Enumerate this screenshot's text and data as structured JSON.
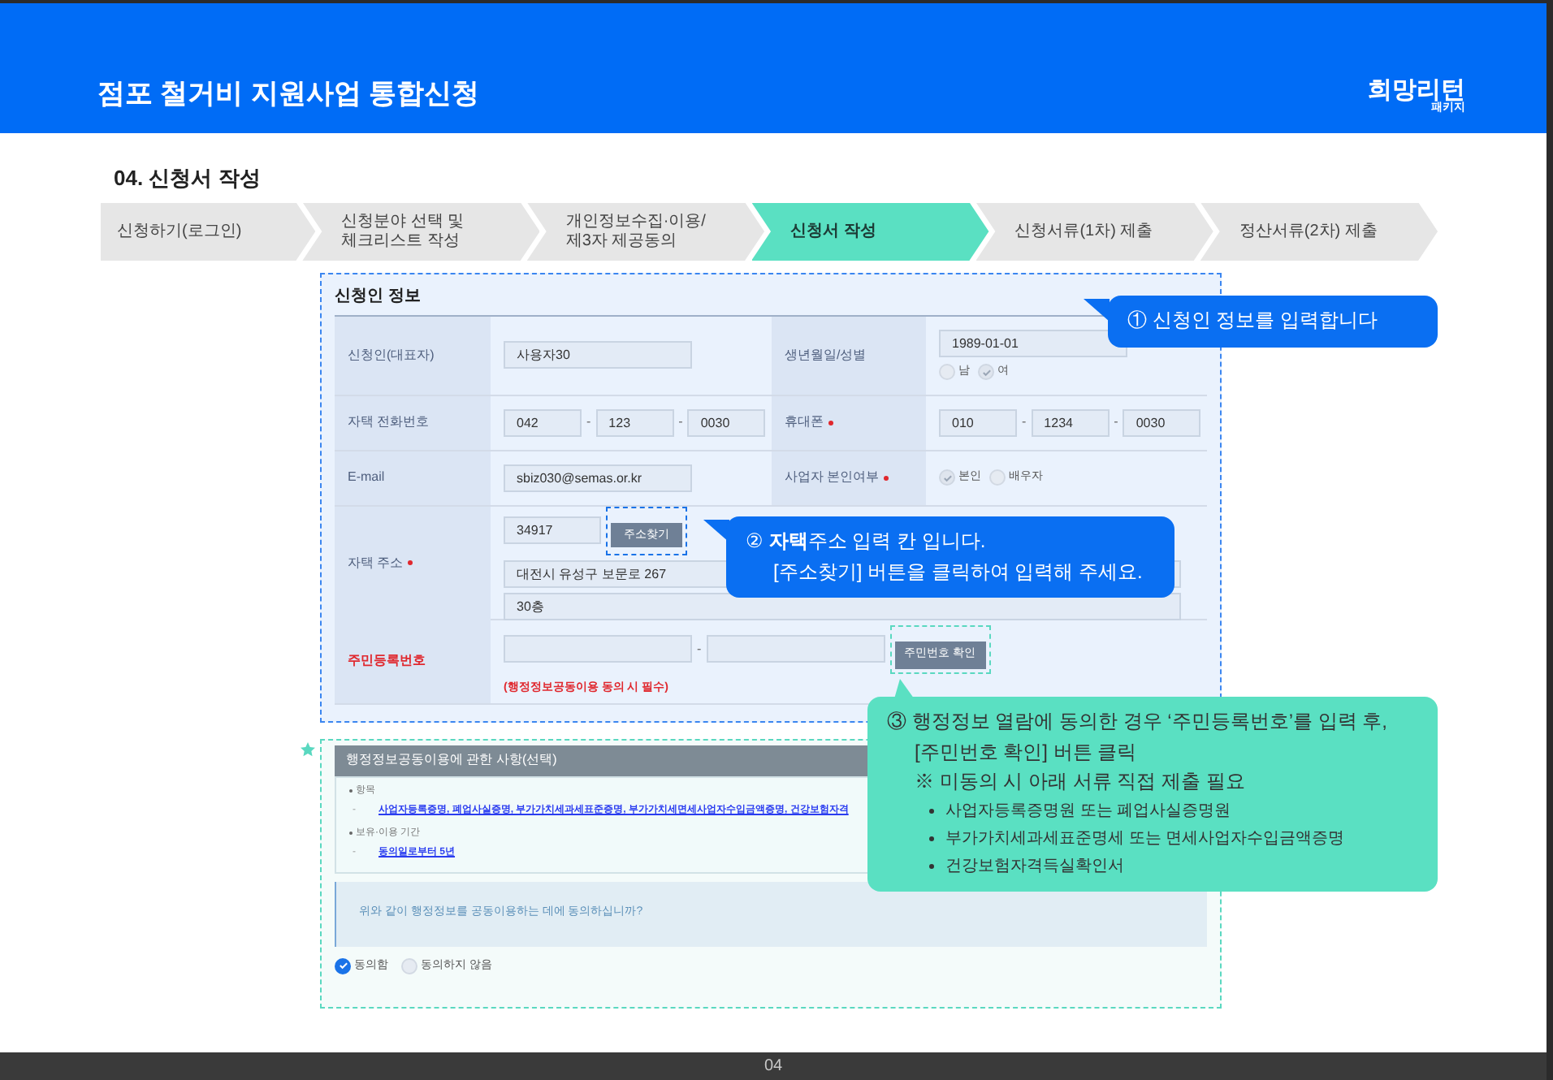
{
  "header": {
    "title": "점포 철거비 지원사업 통합신청",
    "logo": {
      "main": "희망리턴",
      "sub": "패키지"
    }
  },
  "section_title": "04. 신청서 작성",
  "steps": [
    {
      "label": "신청하기(로그인)",
      "selected": false
    },
    {
      "label": "신청분야 선택 및\n체크리스트 작성",
      "selected": false
    },
    {
      "label": "개인정보수집·이용/\n제3자 제공동의",
      "selected": false
    },
    {
      "label": "신청서 작성",
      "selected": true
    },
    {
      "label": "신청서류(1차) 제출",
      "selected": false
    },
    {
      "label": "정산서류(2차) 제출",
      "selected": false
    }
  ],
  "applicant_form": {
    "title": "신청인 정보",
    "rows": [
      {
        "cells": [
          {
            "label": "신청인(대표자)",
            "required": false,
            "kind": "text",
            "value": "사용자30"
          },
          {
            "label": "생년월일/성별",
            "required": false,
            "kind": "date_gender",
            "value": "1989-01-01",
            "options": [
              {
                "label": "남",
                "checked": false
              },
              {
                "label": "여",
                "checked": true
              }
            ]
          }
        ]
      },
      {
        "cells": [
          {
            "label": "자택 전화번호",
            "required": false,
            "kind": "phone",
            "parts": [
              "042",
              "123",
              "0030"
            ],
            "separator": "-"
          },
          {
            "label": "휴대폰",
            "required": true,
            "kind": "phone",
            "parts": [
              "010",
              "1234",
              "0030"
            ],
            "separator": "-"
          }
        ]
      },
      {
        "cells": [
          {
            "label": "E-mail",
            "required": false,
            "kind": "text",
            "value": "sbiz030@semas.or.kr"
          },
          {
            "label": "사업자 본인여부",
            "required": true,
            "kind": "radio",
            "options": [
              {
                "label": "본인",
                "checked": true
              },
              {
                "label": "배우자",
                "checked": false
              }
            ]
          }
        ]
      },
      {
        "cells": [
          {
            "label": "자택 주소",
            "required": true,
            "kind": "address",
            "zip": "34917",
            "button": {
              "label": "주소찾기",
              "highlighted": true
            },
            "lines": [
              "대전시 유성구 보문로 267",
              "30층"
            ]
          }
        ]
      },
      {
        "cells": [
          {
            "label": "주민등록번호",
            "required": false,
            "emphasis": true,
            "kind": "rrn",
            "separator": "-",
            "button": {
              "label": "주민번호 확인",
              "highlighted": true
            },
            "note": "(행정정보공동이용 동의 시 필수)"
          }
        ]
      }
    ]
  },
  "consent": {
    "title": "행정정보공동이용에 관한 사항(선택)",
    "items": [
      {
        "heading": "항목",
        "marker": "-",
        "link": "사업자등록증명, 폐업사실증명, 부가가치세과세표준증명, 부가가치세면세사업자수입금액증명, 건강보험자격"
      },
      {
        "heading": "보유·이용 기간",
        "marker": "-",
        "link": "동의일로부터 5년"
      }
    ],
    "question": "위와 같이 행정정보를 공동이용하는 데에 동의하십니까?",
    "options": [
      {
        "label": "동의함",
        "selected": true
      },
      {
        "label": "동의하지 않음",
        "selected": false
      }
    ]
  },
  "callouts": [
    {
      "kind": "blue",
      "lines": [
        "① 신청인 정보를 입력합니다"
      ]
    },
    {
      "kind": "blue",
      "lines": [
        "② **자택**주소 입력 칸 입니다.",
        "[주소찾기] 버튼을 클릭하여 입력해 주세요."
      ]
    },
    {
      "kind": "teal",
      "lines": [
        "③ 행정정보 열람에 동의한 경우 ‘주민등록번호’를 입력 후,",
        "[주민번호 확인] 버튼 클릭",
        "※ 미동의 시 아래 서류 직접 제출 필요"
      ],
      "bullets": [
        "사업자등록증명원 또는 폐업사실증명원",
        "부가가치세과세표준명세 또는 면세사업자수입금액증명",
        "건강보험자격득실확인서"
      ]
    }
  ],
  "footer": {
    "page": "04"
  }
}
